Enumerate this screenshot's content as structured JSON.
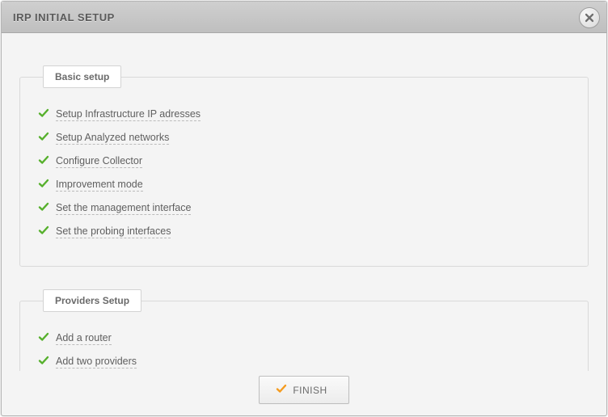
{
  "header": {
    "title": "IRP INITIAL SETUP"
  },
  "groups": [
    {
      "legend": "Basic setup",
      "items": [
        {
          "label": "Setup Infrastructure IP adresses"
        },
        {
          "label": "Setup Analyzed networks"
        },
        {
          "label": "Configure Collector"
        },
        {
          "label": "Improvement mode"
        },
        {
          "label": "Set the management interface"
        },
        {
          "label": "Set the probing interfaces"
        }
      ]
    },
    {
      "legend": "Providers Setup",
      "items": [
        {
          "label": "Add a router"
        },
        {
          "label": "Add two providers"
        }
      ]
    }
  ],
  "footer": {
    "finish_label": "FINISH"
  },
  "colors": {
    "check_green": "#56b02c",
    "check_orange": "#f59b1e"
  }
}
